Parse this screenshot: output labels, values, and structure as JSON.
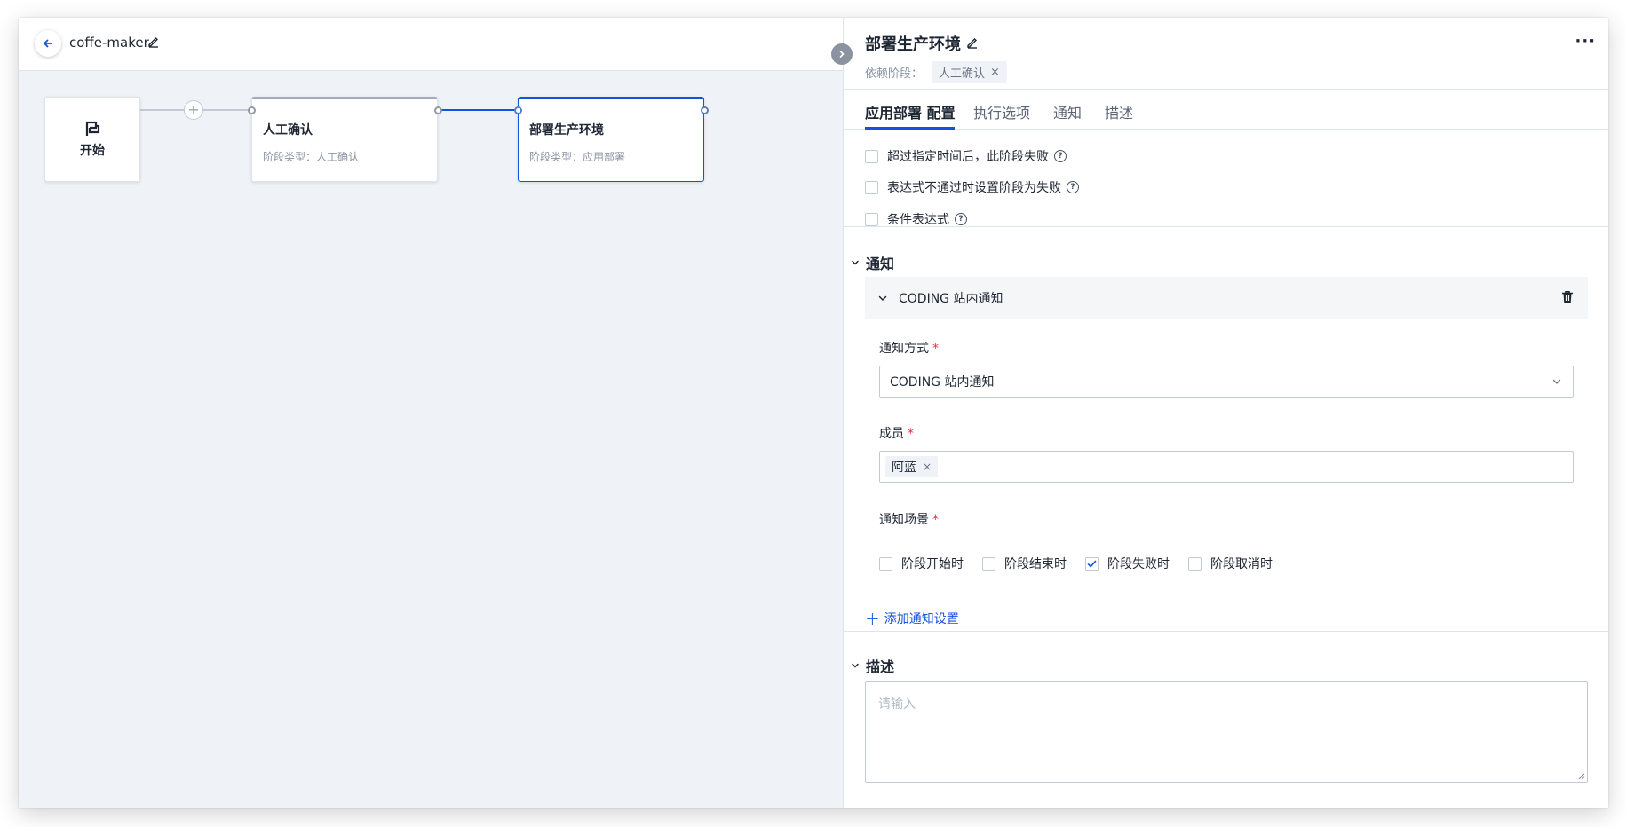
{
  "pipeline": {
    "name": "coffe-maker"
  },
  "canvas": {
    "start_label": "开始",
    "plus_symbol": "+",
    "stages": [
      {
        "title": "人工确认",
        "type_label": "阶段类型：人工确认"
      },
      {
        "title": "部署生产环境",
        "type_label": "阶段类型：应用部署"
      }
    ]
  },
  "panel": {
    "title": "部署生产环境",
    "more": "···",
    "dependency_label": "依赖阶段：",
    "dependency_tag": "人工确认",
    "tag_remove": "×",
    "tabs": [
      {
        "label": "应用部署 配置",
        "active": true
      },
      {
        "label": "执行选项",
        "active": false
      },
      {
        "label": "通知",
        "active": false
      },
      {
        "label": "描述",
        "active": false
      }
    ],
    "options": [
      {
        "label": "超过指定时间后，此阶段失败",
        "checked": false
      },
      {
        "label": "表达式不通过时设置阶段为失败",
        "checked": false
      },
      {
        "label": "条件表达式",
        "checked": false
      }
    ],
    "help_symbol": "?",
    "notify_section": {
      "title": "通知",
      "card_title": "CODING 站内通知",
      "method_label": "通知方式",
      "method_value": "CODING 站内通知",
      "members_label": "成员",
      "members": [
        "阿蓝"
      ],
      "scene_label": "通知场景",
      "required_mark": "*",
      "scenes": [
        {
          "label": "阶段开始时",
          "checked": false
        },
        {
          "label": "阶段结束时",
          "checked": false
        },
        {
          "label": "阶段失败时",
          "checked": true
        },
        {
          "label": "阶段取消时",
          "checked": false
        }
      ],
      "add_label": "添加通知设置"
    },
    "desc_section": {
      "title": "描述",
      "placeholder": "请输入"
    }
  },
  "colors": {
    "accent": "#1452e0",
    "required": "#e5323b",
    "muted": "#8a93a3"
  }
}
